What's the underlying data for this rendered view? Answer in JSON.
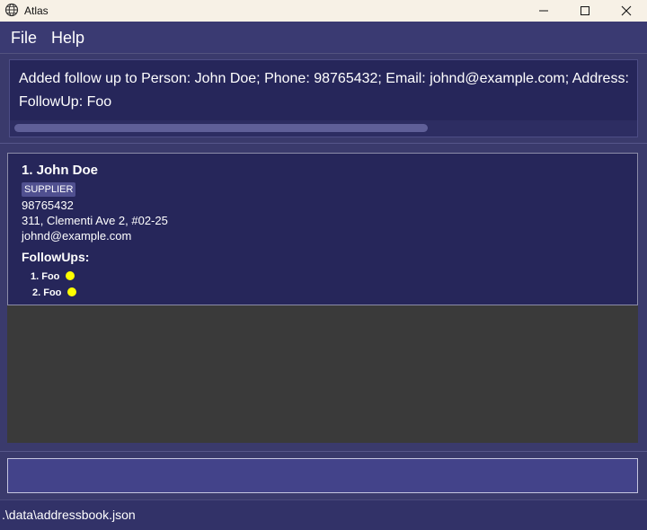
{
  "window": {
    "title": "Atlas"
  },
  "menu": {
    "file": "File",
    "help": "Help"
  },
  "result": {
    "line1": "Added follow up to Person: John Doe; Phone: 98765432; Email: johnd@example.com; Address:",
    "line2": "FollowUp: Foo"
  },
  "person": {
    "index_name": "1. John Doe",
    "tag": "SUPPLIER",
    "phone": "98765432",
    "address": "311, Clementi Ave 2, #02-25",
    "email": "johnd@example.com",
    "followups_title": "FollowUps:",
    "followups": [
      {
        "label": "1. Foo",
        "status_color": "#ffff00"
      },
      {
        "label": "2. Foo",
        "status_color": "#ffff00"
      }
    ]
  },
  "command": {
    "value": ""
  },
  "status": {
    "path": ".\\data\\addressbook.json"
  }
}
